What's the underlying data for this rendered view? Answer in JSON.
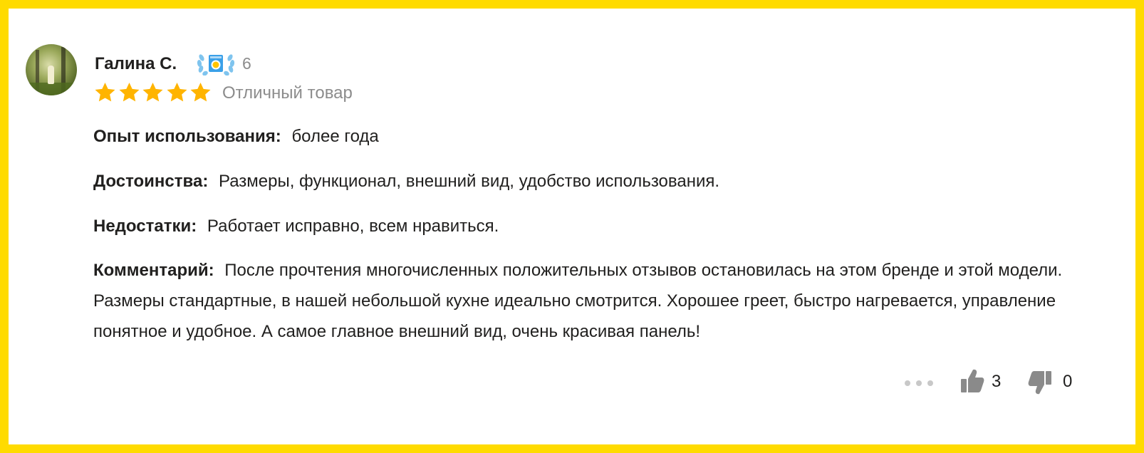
{
  "author": {
    "name": "Галина С.",
    "badge_count": "6",
    "badge_icon": "laurel-washing-machine-icon"
  },
  "rating": {
    "stars": 5,
    "max": 5,
    "label": "Отличный товар",
    "star_color": "#ffb400"
  },
  "review": {
    "experience_label": "Опыт использования:",
    "experience_value": "более года",
    "pros_label": "Достоинства:",
    "pros_value": "Размеры, функционал, внешний вид, удобство использования.",
    "cons_label": "Недостатки:",
    "cons_value": "Работает исправно, всем нравиться.",
    "comment_label": "Комментарий:",
    "comment_value": "После прочтения многочисленных положительных отзывов остановилась на этом бренде и этой модели. Размеры стандартные, в нашей небольшой кухне идеально смотрится. Хорошее греет, быстро нагревается, управление понятное и удобное. А самое главное внешний вид, очень красивая панель!"
  },
  "actions": {
    "more_icon": "more-dots-icon",
    "likes": "3",
    "dislikes": "0"
  },
  "colors": {
    "frame": "#ffdb00",
    "text": "#21201f",
    "muted": "#8c8c8c"
  }
}
